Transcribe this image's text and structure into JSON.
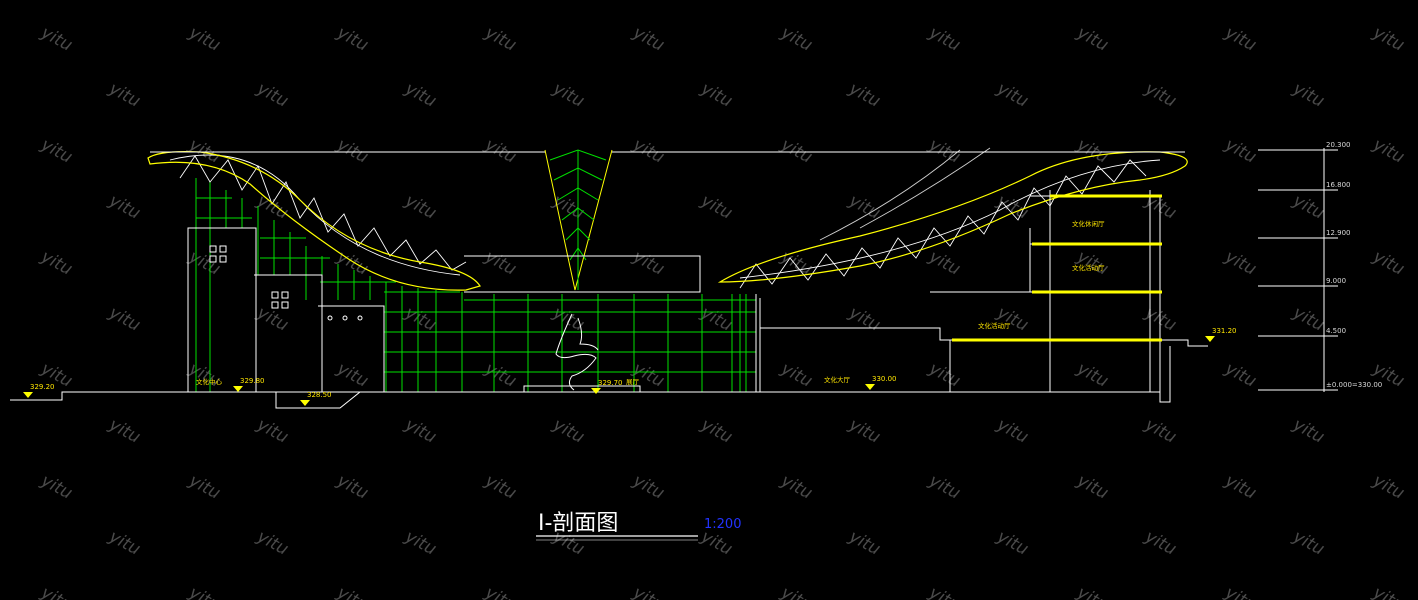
{
  "watermark": {
    "text": "yitu"
  },
  "drawing": {
    "title": "I-剖面图",
    "scale": "1:200"
  },
  "level_marks": [
    {
      "label": "20.300"
    },
    {
      "label": "16.800"
    },
    {
      "label": "12.900"
    },
    {
      "label": "9.000"
    },
    {
      "label": "4.500"
    },
    {
      "label": "±0.000=330.00"
    }
  ],
  "elevation_marks": [
    {
      "label": "329.20"
    },
    {
      "label": "329.80"
    },
    {
      "label": "328.50"
    },
    {
      "label": "329.70"
    },
    {
      "label": "330.00"
    },
    {
      "label": "331.20"
    }
  ],
  "room_labels": [
    {
      "label": "文化中心"
    },
    {
      "label": "展厅"
    },
    {
      "label": "文化大厅"
    },
    {
      "label": "文化活动厅"
    },
    {
      "label": "文化休闲厅"
    },
    {
      "label": "文化活动厅"
    }
  ],
  "colors": {
    "background": "#000000",
    "outline": "#ffffff",
    "roof": "#ffff00",
    "grid": "#00e000",
    "truss": "#ffffff",
    "watermark": "#4a4a4a",
    "scale": "#2233ff"
  }
}
